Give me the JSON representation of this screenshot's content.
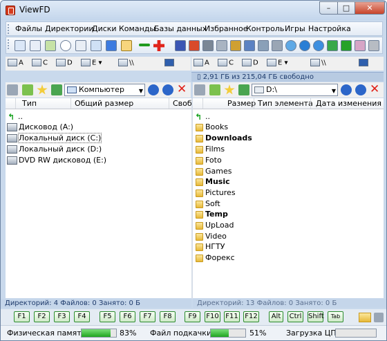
{
  "window": {
    "title": "ViewFD"
  },
  "menu": [
    "Файлы",
    "Директории",
    "Диски",
    "Команды",
    "Базы данных",
    "Избранное",
    "Контроль",
    "Игры",
    "Настройка"
  ],
  "left_panel": {
    "drives": [
      "A",
      "C",
      "D",
      "E",
      "\\\\"
    ],
    "path": "Компьютер",
    "columns": [
      "Тип",
      "Общий размер",
      "Свобо"
    ],
    "items": [
      {
        "name": ".."
      },
      {
        "name": "Дисковод (A:)"
      },
      {
        "name": "Локальный диск (C:)"
      },
      {
        "name": "Локальный диск (D:)"
      },
      {
        "name": "DVD RW дисковод (E:)"
      }
    ],
    "status": "Директорий: 4   Файлов: 0   Занято: 0 Б"
  },
  "right_panel": {
    "drives": [
      "A",
      "C",
      "D",
      "E",
      "\\\\"
    ],
    "free_space": "2,91 ГБ из 215,04 ГБ свободно",
    "path": "D:\\",
    "columns": [
      "Размер",
      "Тип элемента",
      "Дата изменения"
    ],
    "items": [
      {
        "name": "..",
        "bold": false
      },
      {
        "name": "Books",
        "bold": false
      },
      {
        "name": "Downloads",
        "bold": true
      },
      {
        "name": "Films",
        "bold": false
      },
      {
        "name": "Foto",
        "bold": false
      },
      {
        "name": "Games",
        "bold": false
      },
      {
        "name": "Music",
        "bold": true
      },
      {
        "name": "Pictures",
        "bold": false
      },
      {
        "name": "Soft",
        "bold": false
      },
      {
        "name": "Temp",
        "bold": true
      },
      {
        "name": "UpLoad",
        "bold": false
      },
      {
        "name": "Video",
        "bold": false
      },
      {
        "name": "НГТУ",
        "bold": false
      },
      {
        "name": "Форекс",
        "bold": false
      }
    ],
    "status": "Директорий: 13   Файлов: 0   Занято: 0 Б"
  },
  "fkeys": [
    "F1",
    "F2",
    "F3",
    "F4",
    "F5",
    "F6",
    "F7",
    "F8",
    "F9",
    "F10",
    "F11",
    "F12",
    "Alt",
    "Ctrl",
    "Shift",
    "Tab"
  ],
  "bottom": {
    "phys_mem_label": "Физическая память:",
    "phys_mem_value": "83%",
    "phys_mem_pct": 83,
    "swap_label": "Файл подкачки:",
    "swap_value": "51%",
    "swap_pct": 51,
    "cpu_label": "Загрузка ЦП:",
    "cpu_pct": 0
  },
  "colors": {
    "accent": "#c9d9ec",
    "gauge": "#1fa51f",
    "status_text": "#1d3a6b"
  }
}
